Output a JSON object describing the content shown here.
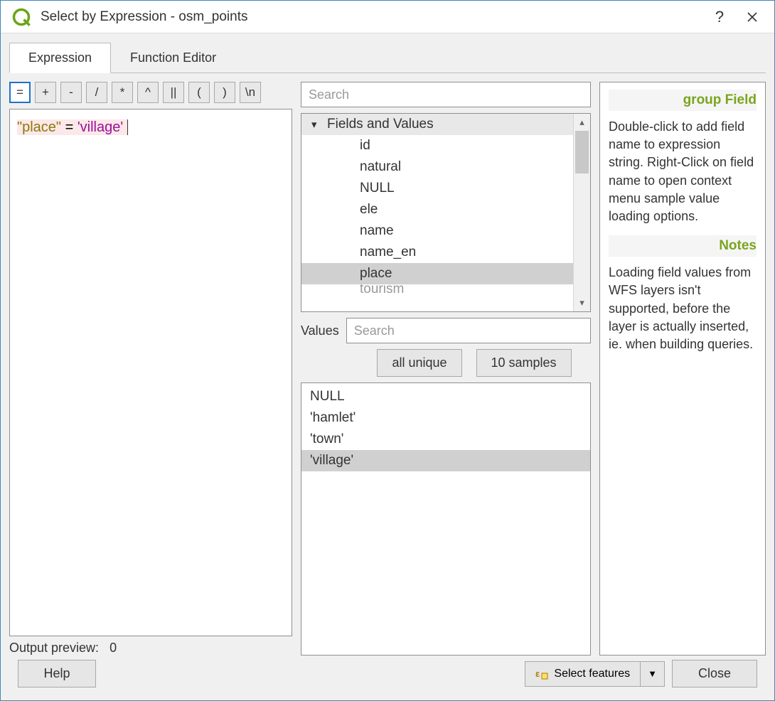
{
  "window": {
    "title": "Select by Expression - osm_points"
  },
  "tabs": {
    "expression": "Expression",
    "function_editor": "Function Editor"
  },
  "operators": {
    "eq": "=",
    "plus": "+",
    "minus": "-",
    "slash": "/",
    "star": "*",
    "caret": "^",
    "concat": "||",
    "lparen": "(",
    "rparen": ")",
    "newline": "\\n"
  },
  "expression": {
    "field": "\"place\"",
    "op": " = ",
    "value": "'village'"
  },
  "preview": {
    "label": "Output preview:",
    "value": "0"
  },
  "search": {
    "placeholder": "Search"
  },
  "tree": {
    "header": "Fields and Values",
    "items": [
      "id",
      "natural",
      "NULL",
      "ele",
      "name",
      "name_en",
      "place",
      "tourism"
    ],
    "selected": "place"
  },
  "values": {
    "label": "Values",
    "search_placeholder": "Search",
    "all_unique": "all unique",
    "ten_samples": "10 samples",
    "list": [
      "NULL",
      "'hamlet'",
      "'town'",
      "'village'"
    ],
    "selected": "'village'"
  },
  "help": {
    "heading1": "group Field",
    "para1": "Double-click to add field name to expression string. Right-Click on field name to open context menu sample value loading options.",
    "heading2": "Notes",
    "para2": "Loading field values from WFS layers isn't supported, before the layer is actually inserted, ie. when building queries."
  },
  "footer": {
    "help": "Help",
    "select_features": "Select features",
    "close": "Close"
  }
}
